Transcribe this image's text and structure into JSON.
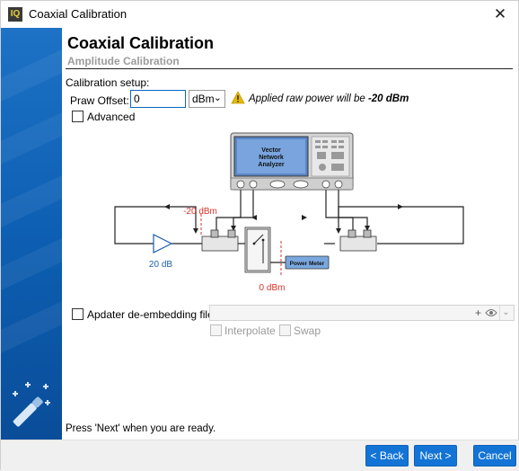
{
  "window": {
    "title": "Coaxial Calibration",
    "app_icon_text": "IQ",
    "close_icon": "close-icon"
  },
  "header": {
    "title": "Coaxial Calibration",
    "subtitle": "Amplitude Calibration"
  },
  "setup": {
    "section_label": "Calibration setup:",
    "praw_label": "Praw Offset:",
    "praw_value": "0",
    "unit_value": "dBm",
    "warning_prefix": "Applied raw power will be ",
    "warning_value": "-20 dBm",
    "advanced_label": "Advanced",
    "advanced_checked": false
  },
  "diagram": {
    "vna_line1": "Vector",
    "vna_line2": "Network",
    "vna_line3": "Analyzer",
    "level_minus20": "-20 dBm",
    "amp_gain": "20 dB",
    "level_zero": "0 dBm",
    "power_meter": "Power Meter"
  },
  "deembed": {
    "label": "Apdater de-embedding file:",
    "value": "",
    "interpolate_label": "Interpolate",
    "swap_label": "Swap"
  },
  "status": {
    "ready_text": "Press 'Next' when you are ready."
  },
  "footer": {
    "back_label": "< Back",
    "next_label": "Next >",
    "cancel_label": "Cancel"
  },
  "colors": {
    "accent": "#1374d6",
    "sidebar": "#0d5fb3",
    "warning": "#e6b800",
    "level_red": "#d9342b",
    "gain_blue": "#1c5fb0"
  }
}
